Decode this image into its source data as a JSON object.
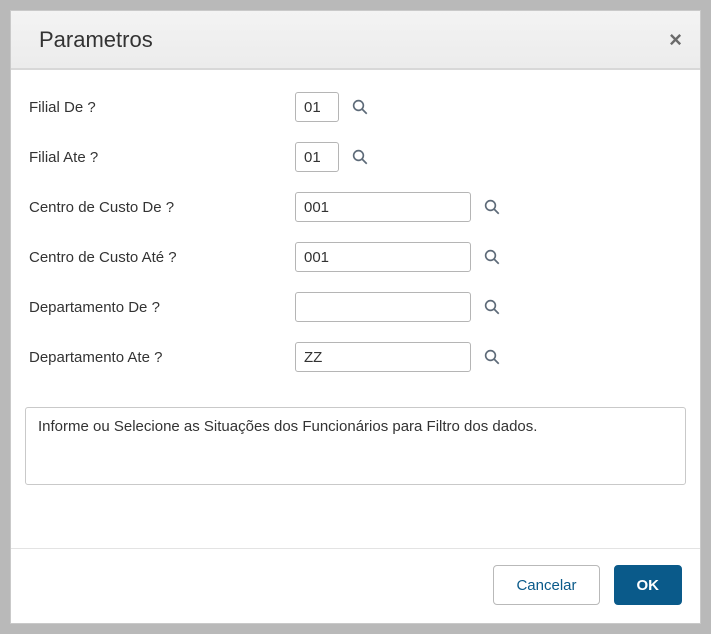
{
  "dialog": {
    "title": "Parametros",
    "close_label": "×"
  },
  "fields": {
    "filial_de": {
      "label": "Filial De ?",
      "value": "01",
      "size": "sm"
    },
    "filial_ate": {
      "label": "Filial Ate ?",
      "value": "01",
      "size": "sm"
    },
    "cc_de": {
      "label": "Centro de Custo De ?",
      "value": "001",
      "size": "md"
    },
    "cc_ate": {
      "label": "Centro de Custo Até ?",
      "value": "001",
      "size": "md"
    },
    "dep_de": {
      "label": "Departamento De ?",
      "value": "",
      "size": "md"
    },
    "dep_ate": {
      "label": "Departamento Ate ?",
      "value": "ZZ",
      "size": "md"
    }
  },
  "help_text": "Informe ou Selecione as Situações dos Funcionários para Filtro dos dados.",
  "buttons": {
    "cancel": "Cancelar",
    "ok": "OK"
  }
}
